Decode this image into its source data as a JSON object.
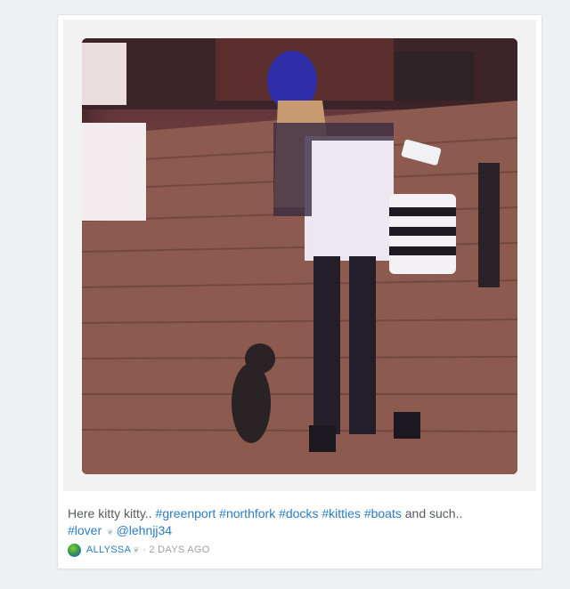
{
  "post": {
    "caption_text": "Here kitty kitty.. ",
    "hashtags": [
      "#greenport",
      "#northfork",
      "#docks",
      "#kitties",
      "#boats"
    ],
    "caption_tail": " and such..",
    "hashtag_lover": "#lover",
    "emoji": "❦",
    "mention": "@lehnjj34",
    "username": "ALLYSSA",
    "user_emoji": "❦",
    "time_ago": "2 DAYS AGO"
  },
  "colors": {
    "link": "#2a7cc7",
    "text": "#555b60",
    "meta": "#9aa1a6"
  }
}
